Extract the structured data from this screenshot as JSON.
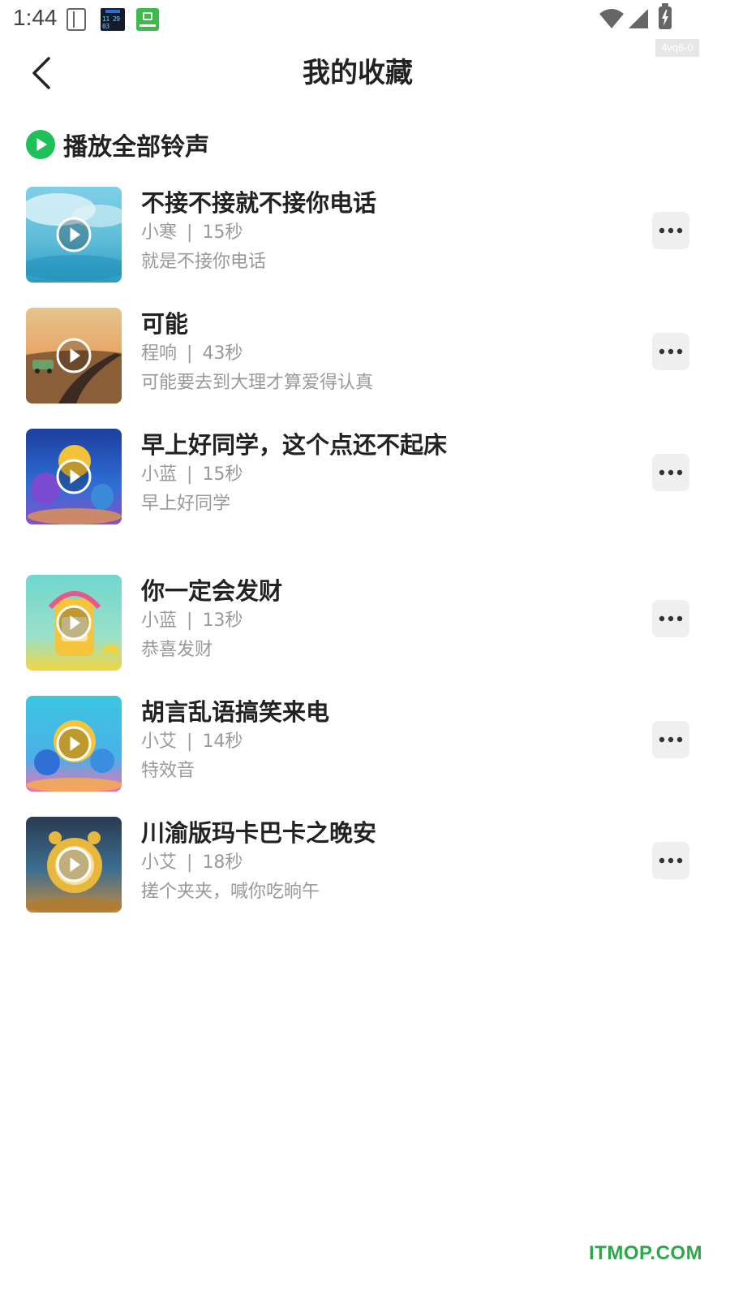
{
  "status_bar": {
    "time": "1:44",
    "clock_widget_text": "11 29 03",
    "icons": [
      "sim-icon",
      "clock-app-icon",
      "ringtone-app-icon",
      "wifi-icon",
      "signal-icon",
      "battery-charging-icon"
    ],
    "version_tag": "4vq6-0"
  },
  "header": {
    "back_icon": "chevron-left-icon",
    "title": "我的收藏"
  },
  "play_all": {
    "icon": "play-circle-icon",
    "label": "播放全部铃声",
    "accent_color": "#1fbf5a"
  },
  "ringtones": [
    {
      "title": "不接不接就不接你电话",
      "artist": "小寒",
      "separator": "|",
      "duration": "15秒",
      "description": "就是不接你电话",
      "cover_icon": "play-circle-icon",
      "more_icon": "more-horizontal-icon"
    },
    {
      "title": "可能",
      "artist": "程响",
      "separator": "|",
      "duration": "43秒",
      "description": "可能要去到大理才算爱得认真",
      "cover_icon": "play-circle-icon",
      "more_icon": "more-horizontal-icon"
    },
    {
      "title": "早上好同学，这个点还不起床",
      "artist": "小蓝",
      "separator": "|",
      "duration": "15秒",
      "description": "早上好同学",
      "cover_icon": "play-circle-icon",
      "more_icon": "more-horizontal-icon"
    },
    {
      "title": "你一定会发财",
      "artist": "小蓝",
      "separator": "|",
      "duration": "13秒",
      "description": "恭喜发财",
      "cover_icon": "play-circle-icon",
      "more_icon": "more-horizontal-icon"
    },
    {
      "title": "胡言乱语搞笑来电",
      "artist": "小艾",
      "separator": "|",
      "duration": "14秒",
      "description": "特效音",
      "cover_icon": "play-circle-icon",
      "more_icon": "more-horizontal-icon"
    },
    {
      "title": "川渝版玛卡巴卡之晚安",
      "artist": "小艾",
      "separator": "|",
      "duration": "18秒",
      "description": "搓个夹夹，喊你吃晌午",
      "cover_icon": "play-circle-icon",
      "more_icon": "more-horizontal-icon"
    }
  ],
  "watermark": "ITMOP.COM",
  "colors": {
    "accent_green": "#1fbf5a",
    "title_text": "#222222",
    "secondary_text": "#999999",
    "more_button_bg": "#efefef",
    "watermark_green": "#2ea64a"
  }
}
